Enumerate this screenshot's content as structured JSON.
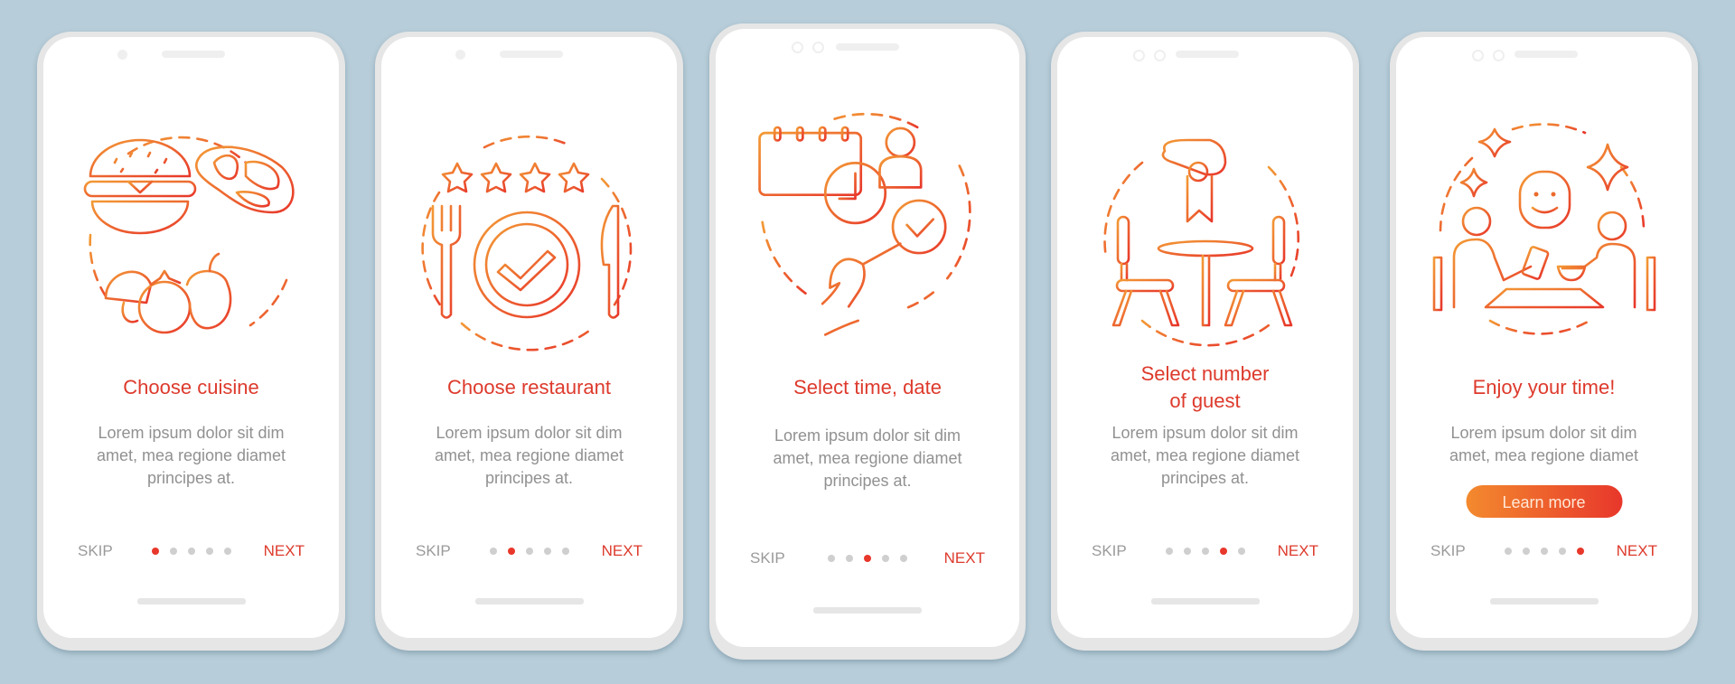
{
  "colors": {
    "background": "#b7cdd9",
    "accent_red": "#dd3a2c",
    "accent_orange": "#f38a2e",
    "body_gray": "#919191",
    "dot_inactive": "#cfcfcf"
  },
  "common": {
    "skip_label": "SKIP",
    "next_label": "NEXT",
    "body": [
      "Lorem ipsum dolor sit dim",
      "amet, mea regione diamet",
      "principes at."
    ]
  },
  "screens": [
    {
      "title": [
        "Choose cuisine"
      ],
      "icon": "food-cuisine-icon",
      "active_page": 1,
      "total_pages": 5
    },
    {
      "title": [
        "Choose restaurant"
      ],
      "icon": "restaurant-rating-icon",
      "active_page": 2,
      "total_pages": 5
    },
    {
      "title": [
        "Select time, date"
      ],
      "icon": "calendar-clock-icon",
      "active_page": 3,
      "total_pages": 5
    },
    {
      "title": [
        "Select number",
        "of guest"
      ],
      "icon": "table-reservation-icon",
      "active_page": 4,
      "total_pages": 5
    },
    {
      "title": [
        "Enjoy your time!"
      ],
      "icon": "dining-together-icon",
      "active_page": 5,
      "total_pages": 5,
      "body": [
        "Lorem ipsum dolor sit dim",
        "amet, mea regione diamet"
      ],
      "cta_label": "Learn more"
    }
  ]
}
